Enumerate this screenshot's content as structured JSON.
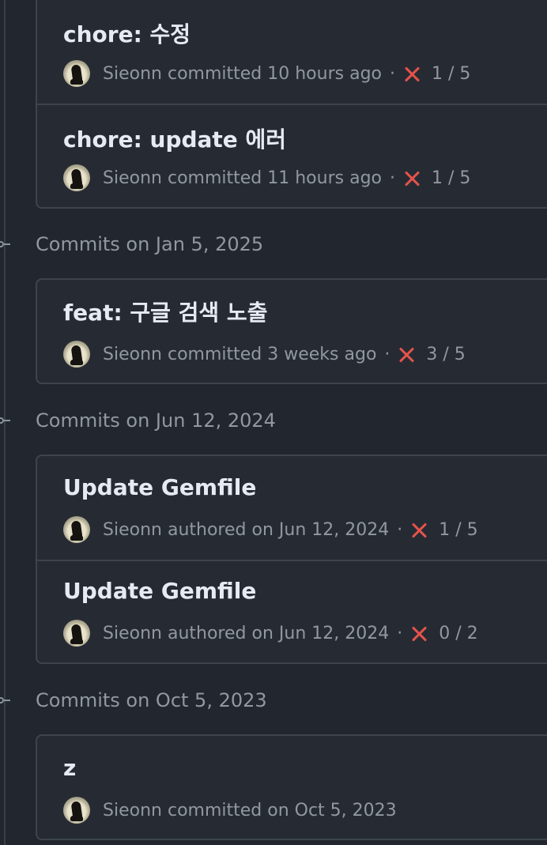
{
  "groups": [
    {
      "header": "",
      "commits": [
        {
          "title": "chore: 수정",
          "author": "Sieonn",
          "action": "committed",
          "when": "10 hours ago",
          "checks": "1 / 5",
          "status": "failed"
        },
        {
          "title": "chore: update 에러",
          "author": "Sieonn",
          "action": "committed",
          "when": "11 hours ago",
          "checks": "1 / 5",
          "status": "failed"
        }
      ]
    },
    {
      "header": "Commits on Jan 5, 2025",
      "commits": [
        {
          "title": "feat: 구글 검색 노출",
          "author": "Sieonn",
          "action": "committed",
          "when": "3 weeks ago",
          "checks": "3 / 5",
          "status": "failed"
        }
      ]
    },
    {
      "header": "Commits on Jun 12, 2024",
      "commits": [
        {
          "title": "Update Gemfile",
          "author": "Sieonn",
          "action": "authored",
          "when": "on Jun 12, 2024",
          "checks": "1 / 5",
          "status": "failed"
        },
        {
          "title": "Update Gemfile",
          "author": "Sieonn",
          "action": "authored",
          "when": "on Jun 12, 2024",
          "checks": "0 / 2",
          "status": "failed"
        }
      ]
    },
    {
      "header": "Commits on Oct 5, 2023",
      "commits": [
        {
          "title": "z",
          "author": "Sieonn",
          "action": "committed",
          "when": "on Oct 5, 2023",
          "checks": "",
          "status": ""
        }
      ]
    }
  ],
  "colors": {
    "background": "#22262e",
    "card": "#262b33",
    "border": "#3d444d",
    "muted": "#9198a1",
    "failed": "#e5534b"
  },
  "icons": {
    "commit_node": "git-commit-icon",
    "failed": "x-icon",
    "avatar": "user-avatar"
  }
}
